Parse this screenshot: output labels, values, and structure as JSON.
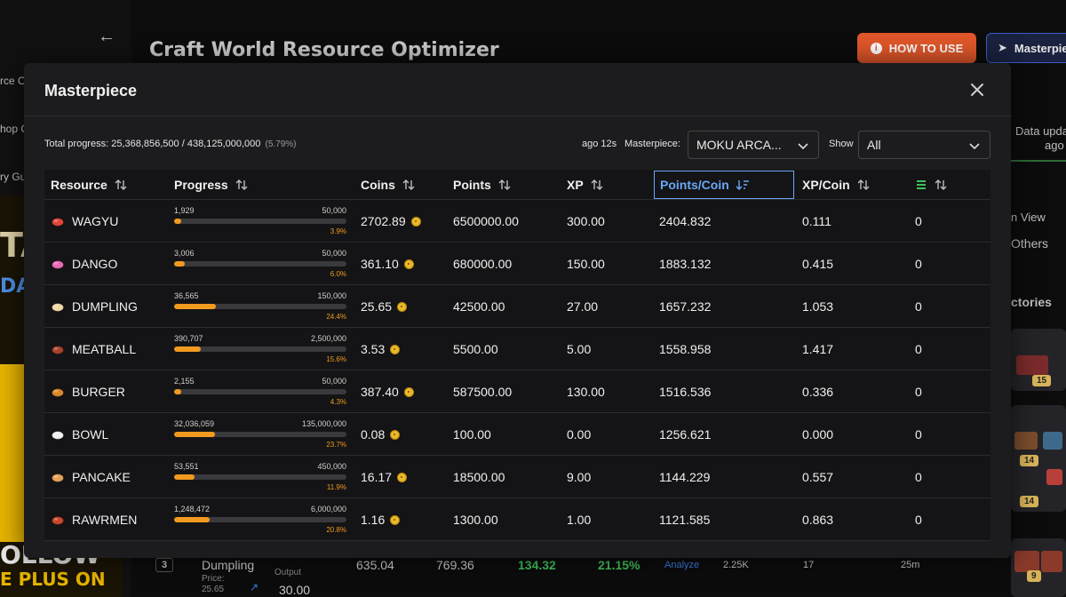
{
  "background": {
    "sidebar_fragments": [
      "rce O",
      "hop O",
      "ry Gu"
    ],
    "promo_lines": [
      "TA",
      "DA",
      "OLLOW",
      "E PLUS ON"
    ],
    "app_title": "Craft World Resource Optimizer",
    "how_to_use_label": "HOW TO USE",
    "masterpiece_btn_label": "Masterpie",
    "right_fragments": {
      "data_updated": "Data upda",
      "ago": "ago",
      "view": "n View",
      "others": "Others",
      "factories": "ctories",
      "badges": [
        "15",
        "14",
        "14",
        "9"
      ]
    },
    "bottom_row": {
      "rank": "3",
      "name": "Dumpling",
      "price_label": "Price:",
      "price": "25.65",
      "output_label": "Output",
      "output": "30.00",
      "v1": "635.04",
      "v2": "769.36",
      "v3": "134.32",
      "v4": "21.15%",
      "analyze": "Analyze",
      "v5": "2.25K",
      "v6": "17",
      "v7": "25m"
    }
  },
  "modal": {
    "title": "Masterpiece",
    "total_progress_text": "Total progress: 25,368,856,500 / 438,125,000,000",
    "total_progress_pct": "(5.79%)",
    "ago_text": "ago 12s",
    "masterpiece_label": "Masterpiece:",
    "masterpiece_selected": "MOKU ARCA...",
    "show_label": "Show",
    "show_selected": "All",
    "columns": [
      "Resource",
      "Progress",
      "Coins",
      "Points",
      "XP",
      "Points/Coin",
      "XP/Coin",
      ""
    ],
    "rows": [
      {
        "name": "WAGYU",
        "icon": "wagyu-icon",
        "color": "#e0463c",
        "cur": "1,929",
        "max": "50,000",
        "pct_label": "3.9%",
        "pct": 3.9,
        "coins": "2702.89",
        "points": "6500000.00",
        "xp": "300.00",
        "ppc": "2404.832",
        "xpc": "0.111",
        "extra": "0"
      },
      {
        "name": "DANGO",
        "icon": "dango-icon",
        "color": "#e86bb5",
        "cur": "3,006",
        "max": "50,000",
        "pct_label": "6.0%",
        "pct": 6.0,
        "coins": "361.10",
        "points": "680000.00",
        "xp": "150.00",
        "ppc": "1883.132",
        "xpc": "0.415",
        "extra": "0"
      },
      {
        "name": "DUMPLING",
        "icon": "dumpling-icon",
        "color": "#f2d9a6",
        "cur": "36,565",
        "max": "150,000",
        "pct_label": "24.4%",
        "pct": 24.4,
        "coins": "25.65",
        "points": "42500.00",
        "xp": "27.00",
        "ppc": "1657.232",
        "xpc": "1.053",
        "extra": "0"
      },
      {
        "name": "MEATBALL",
        "icon": "meatball-icon",
        "color": "#a8432a",
        "cur": "390,707",
        "max": "2,500,000",
        "pct_label": "15.6%",
        "pct": 15.6,
        "coins": "3.53",
        "points": "5500.00",
        "xp": "5.00",
        "ppc": "1558.958",
        "xpc": "1.417",
        "extra": "0"
      },
      {
        "name": "BURGER",
        "icon": "burger-icon",
        "color": "#d9892b",
        "cur": "2,155",
        "max": "50,000",
        "pct_label": "4.3%",
        "pct": 4.3,
        "coins": "387.40",
        "points": "587500.00",
        "xp": "130.00",
        "ppc": "1516.536",
        "xpc": "0.336",
        "extra": "0"
      },
      {
        "name": "BOWL",
        "icon": "bowl-icon",
        "color": "#f0f0f0",
        "cur": "32,036,059",
        "max": "135,000,000",
        "pct_label": "23.7%",
        "pct": 23.7,
        "coins": "0.08",
        "points": "100.00",
        "xp": "0.00",
        "ppc": "1256.621",
        "xpc": "0.000",
        "extra": "0"
      },
      {
        "name": "PANCAKE",
        "icon": "pancake-icon",
        "color": "#e3a25a",
        "cur": "53,551",
        "max": "450,000",
        "pct_label": "11.9%",
        "pct": 11.9,
        "coins": "16.17",
        "points": "18500.00",
        "xp": "9.00",
        "ppc": "1144.229",
        "xpc": "0.557",
        "extra": "0"
      },
      {
        "name": "RAWRMEN",
        "icon": "rawrmen-icon",
        "color": "#c9472b",
        "cur": "1,248,472",
        "max": "6,000,000",
        "pct_label": "20.8%",
        "pct": 20.8,
        "coins": "1.16",
        "points": "1300.00",
        "xp": "1.00",
        "ppc": "1121.585",
        "xpc": "0.863",
        "extra": "0"
      }
    ]
  }
}
